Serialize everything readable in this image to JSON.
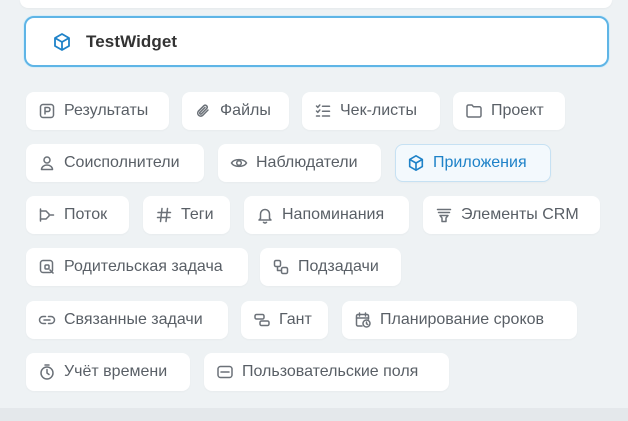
{
  "widget": {
    "title": "TestWidget",
    "icon": "cube-icon"
  },
  "chips": [
    {
      "id": "results",
      "label": "Результаты",
      "icon": "results-icon"
    },
    {
      "id": "files",
      "label": "Файлы",
      "icon": "paperclip-icon"
    },
    {
      "id": "checklists",
      "label": "Чек-листы",
      "icon": "checklist-icon"
    },
    {
      "id": "project",
      "label": "Проект",
      "icon": "folder-icon"
    },
    {
      "id": "coexecutors",
      "label": "Соисполнители",
      "icon": "user-icon"
    },
    {
      "id": "observers",
      "label": "Наблюдатели",
      "icon": "eye-icon"
    },
    {
      "id": "apps",
      "label": "Приложения",
      "icon": "cube-icon",
      "active": true
    },
    {
      "id": "flow",
      "label": "Поток",
      "icon": "flow-icon"
    },
    {
      "id": "tags",
      "label": "Теги",
      "icon": "hash-icon"
    },
    {
      "id": "reminders",
      "label": "Напоминания",
      "icon": "bell-icon"
    },
    {
      "id": "crm",
      "label": "Элементы CRM",
      "icon": "crm-icon"
    },
    {
      "id": "parent_task",
      "label": "Родительская задача",
      "icon": "parent-task-icon"
    },
    {
      "id": "subtasks",
      "label": "Подзадачи",
      "icon": "subtasks-icon"
    },
    {
      "id": "related",
      "label": "Связанные задачи",
      "icon": "link-icon"
    },
    {
      "id": "gantt",
      "label": "Гант",
      "icon": "gantt-icon"
    },
    {
      "id": "planning",
      "label": "Планирование сроков",
      "icon": "calendar-clock-icon"
    },
    {
      "id": "time_tracking",
      "label": "Учёт времени",
      "icon": "stopwatch-icon"
    },
    {
      "id": "custom_fields",
      "label": "Пользовательские поля",
      "icon": "custom-fields-icon"
    }
  ],
  "colors": {
    "accent": "#1e82c8",
    "border_active": "#5fb5e6",
    "text": "#595f66",
    "background": "#eef2f4"
  }
}
